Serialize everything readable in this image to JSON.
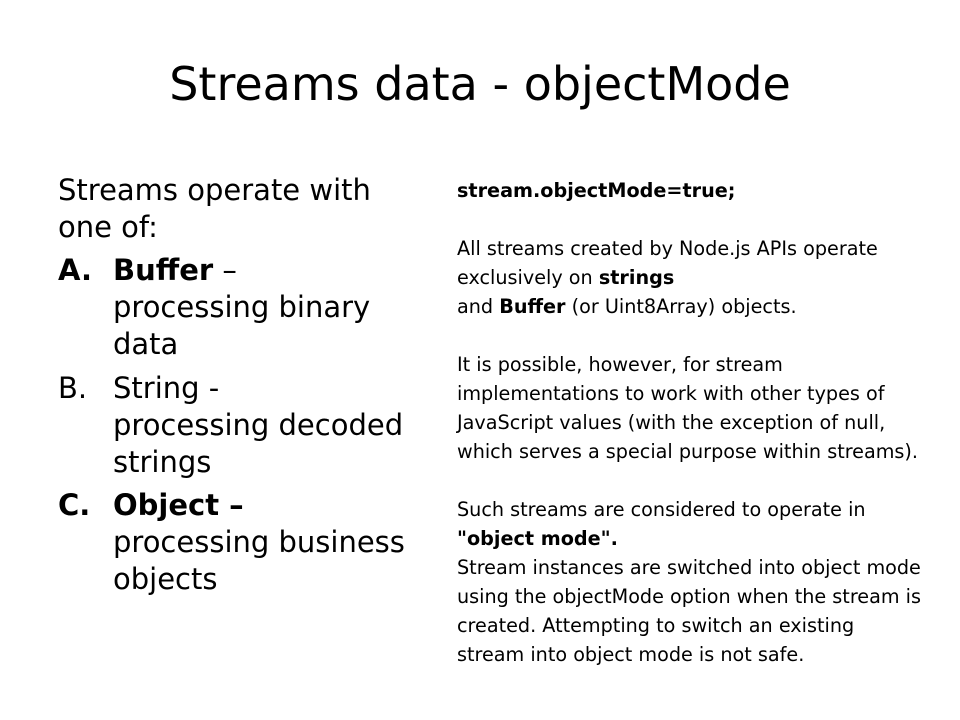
{
  "title": "Streams data - objectMode",
  "left": {
    "intro": "Streams operate with one of:",
    "items": [
      {
        "marker": "A.",
        "name": "Buffer",
        "separator": " –",
        "desc": "processing binary data",
        "bold_marker": true
      },
      {
        "marker": "B.",
        "name": "String -",
        "separator": "",
        "desc": "processing decoded strings",
        "bold_marker": false
      },
      {
        "marker": "C.",
        "name": "Object –",
        "separator": "",
        "desc": "processing business objects",
        "bold_marker": true
      }
    ]
  },
  "right": {
    "code_line": "stream.objectMode=true;",
    "p1_a": "All streams created by Node.js APIs operate exclusively on ",
    "p1_strings": "strings",
    "p1_b": "and ",
    "p1_buffer": "Buffer",
    "p1_c": " (or Uint8Array) objects.",
    "p2": "It is possible, however, for stream implementations to work with other types of JavaScript values (with the exception of null, which serves a special purpose within streams).",
    "p3_a": "Such streams are considered to operate in ",
    "p3_object_mode": "\"object mode\".",
    "p3_b": "Stream instances are switched into object mode using the objectMode option when the stream is created. Attempting to switch an existing stream into object mode is not safe."
  }
}
